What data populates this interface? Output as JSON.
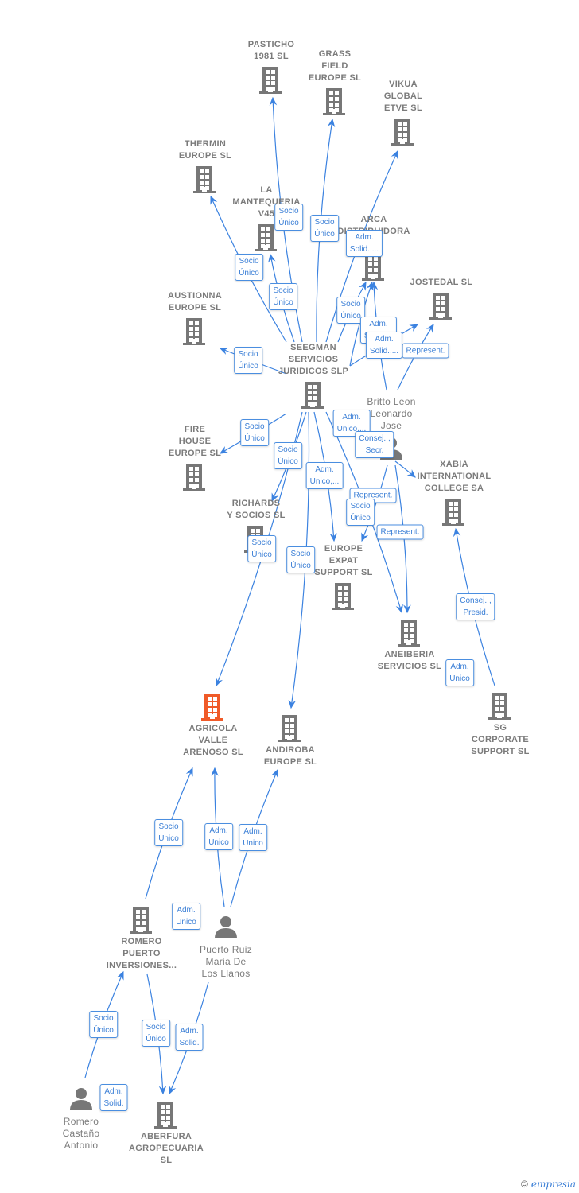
{
  "colors": {
    "edge": "#3b82e0",
    "company": "#777777",
    "highlight": "#f05a28",
    "label_border": "#4a8ee0"
  },
  "nodes": [
    {
      "id": "pasticho",
      "type": "company",
      "name": "PASTICHO\n1981  SL"
    },
    {
      "id": "grass",
      "type": "company",
      "name": "GRASS\nFIELD\nEUROPE  SL"
    },
    {
      "id": "vikua",
      "type": "company",
      "name": "VIKUA\nGLOBAL\nETVE  SL"
    },
    {
      "id": "thermin",
      "type": "company",
      "name": "THERMIN\nEUROPE  SL"
    },
    {
      "id": "mantequeria",
      "type": "company",
      "name": "LA\nMANTEQUERIA\nV45"
    },
    {
      "id": "arca",
      "type": "company",
      "name": "ARCA\nDISTRIBUIDORA\nA..."
    },
    {
      "id": "jostedal",
      "type": "company",
      "name": "JOSTEDAL  SL"
    },
    {
      "id": "austionna",
      "type": "company",
      "name": "AUSTIONNA\nEUROPE  SL"
    },
    {
      "id": "seegman",
      "type": "company",
      "name": "SEEGMAN\nSERVICIOS\nJURIDICOS  SLP"
    },
    {
      "id": "britto",
      "type": "person",
      "name": "Britto Leon\nLeonardo\nJose"
    },
    {
      "id": "fire",
      "type": "company",
      "name": "FIRE\nHOUSE\nEUROPE  SL"
    },
    {
      "id": "xabia",
      "type": "company",
      "name": "XABIA\nINTERNATIONAL\nCOLLEGE SA"
    },
    {
      "id": "richards",
      "type": "company",
      "name": "RICHARDS\nY SOCIOS  SL"
    },
    {
      "id": "expat",
      "type": "company",
      "name": "EUROPE\nEXPAT\nSUPPORT  SL"
    },
    {
      "id": "aneiberia",
      "type": "company",
      "name": "ANEIBERIA\nSERVICIOS  SL"
    },
    {
      "id": "agricola",
      "type": "highlight",
      "name": "AGRICOLA\nVALLE\nARENOSO  SL"
    },
    {
      "id": "andiroba",
      "type": "company",
      "name": "ANDIROBA\nEUROPE  SL"
    },
    {
      "id": "sg",
      "type": "company",
      "name": "SG\nCORPORATE\nSUPPORT  SL"
    },
    {
      "id": "romeropuerto",
      "type": "company",
      "name": "ROMERO\nPUERTO\nINVERSIONES..."
    },
    {
      "id": "puertoruiz",
      "type": "person",
      "name": "Puerto Ruiz\nMaria De\nLos Llanos"
    },
    {
      "id": "romerocastano",
      "type": "person",
      "name": "Romero\nCastaño\nAntonio"
    },
    {
      "id": "aberfura",
      "type": "company",
      "name": "ABERFURA\nAGROPECUARIA\nSL"
    }
  ],
  "edge_labels": [
    "Socio\nÚnico",
    "Socio\nÚnico",
    "Adm.\nSolid.,...",
    "Socio\nÚnico",
    "Socio\nÚnico",
    "Socio\nÚnico",
    "Adm.\nSolid.,...",
    "Represent.",
    "Adm.\nSolid.,...",
    "Socio\nÚnico",
    "Adm.\nUnico,...",
    "Socio\nÚnico",
    "Consej. ,\nSecr.",
    "Socio\nÚnico",
    "Adm.\nUnico,...",
    "Represent.",
    "Socio\nÚnico",
    "Represent.",
    "Socio\nÚnico",
    "Socio\nÚnico",
    "Consej. ,\nPresid.",
    "Adm.\nUnico",
    "Socio\nÚnico",
    "Adm.\nUnico",
    "Adm.\nUnico",
    "Adm.\nUnico",
    "Socio\nÚnico",
    "Socio\nÚnico",
    "Adm.\nSolid.",
    "Adm.\nSolid."
  ],
  "footer": {
    "copyright": "©",
    "brand": "empresia"
  }
}
